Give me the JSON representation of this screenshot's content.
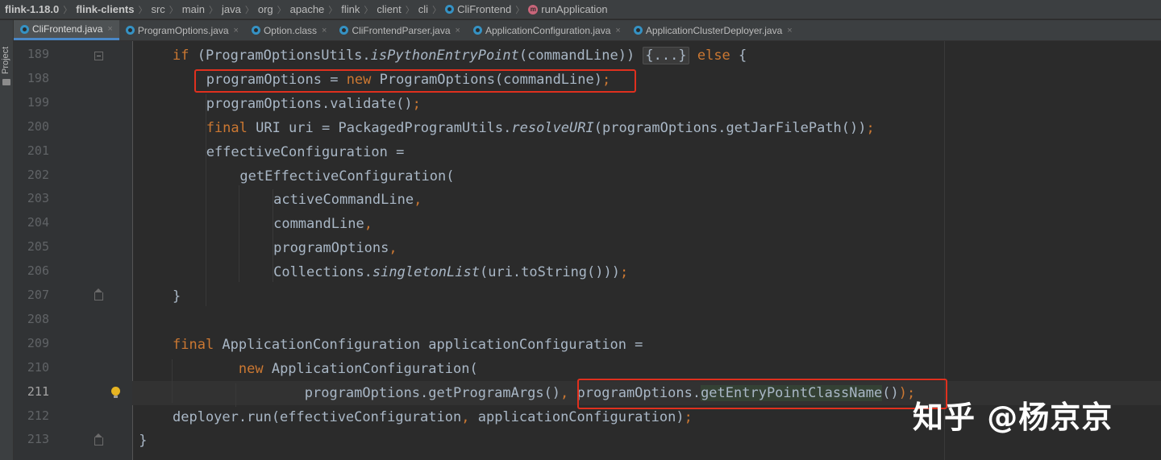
{
  "breadcrumb": [
    {
      "label": "flink-1.18.0",
      "bold": true,
      "icon": ""
    },
    {
      "label": "flink-clients",
      "bold": true,
      "icon": ""
    },
    {
      "label": "src",
      "bold": false,
      "icon": ""
    },
    {
      "label": "main",
      "bold": false,
      "icon": ""
    },
    {
      "label": "java",
      "bold": false,
      "icon": ""
    },
    {
      "label": "org",
      "bold": false,
      "icon": ""
    },
    {
      "label": "apache",
      "bold": false,
      "icon": ""
    },
    {
      "label": "flink",
      "bold": false,
      "icon": ""
    },
    {
      "label": "client",
      "bold": false,
      "icon": ""
    },
    {
      "label": "cli",
      "bold": false,
      "icon": ""
    },
    {
      "label": "CliFrontend",
      "bold": false,
      "icon": "class-icon"
    },
    {
      "label": "runApplication",
      "bold": false,
      "icon": "method-icon"
    }
  ],
  "side_panel": {
    "label": "Project"
  },
  "tabs": [
    {
      "label": "CliFrontend.java",
      "active": true
    },
    {
      "label": "ProgramOptions.java",
      "active": false
    },
    {
      "label": "Option.class",
      "active": false
    },
    {
      "label": "CliFrontendParser.java",
      "active": false
    },
    {
      "label": "ApplicationConfiguration.java",
      "active": false
    },
    {
      "label": "ApplicationClusterDeployer.java",
      "active": false
    }
  ],
  "tab_close": "×",
  "editor": {
    "current_line": "211",
    "lines": [
      {
        "num": "189",
        "indent": 0,
        "tokens": [
          [
            "kw",
            "if "
          ],
          [
            "",
            "(ProgramOptionsUtils."
          ],
          [
            "it",
            "isPythonEntryPoint"
          ],
          [
            "",
            "(commandLine)) "
          ],
          [
            "fold",
            "{...}"
          ],
          [
            "kw",
            " else "
          ],
          [
            "",
            "{"
          ]
        ]
      },
      {
        "num": "198",
        "indent": 1,
        "tokens": [
          [
            "",
            "programOptions = "
          ],
          [
            "kw",
            "new "
          ],
          [
            "",
            "ProgramOptions(commandLine)"
          ],
          [
            "kw",
            ";"
          ]
        ]
      },
      {
        "num": "199",
        "indent": 1,
        "tokens": [
          [
            "",
            "programOptions.validate()"
          ],
          [
            "kw",
            ";"
          ]
        ]
      },
      {
        "num": "200",
        "indent": 1,
        "tokens": [
          [
            "kw",
            "final "
          ],
          [
            "",
            "URI uri = PackagedProgramUtils."
          ],
          [
            "it",
            "resolveURI"
          ],
          [
            "",
            "(programOptions.getJarFilePath())"
          ],
          [
            "kw",
            ";"
          ]
        ]
      },
      {
        "num": "201",
        "indent": 1,
        "tokens": [
          [
            "",
            "effectiveConfiguration ="
          ]
        ]
      },
      {
        "num": "202",
        "indent": 2,
        "tokens": [
          [
            "",
            "getEffectiveConfiguration("
          ]
        ]
      },
      {
        "num": "203",
        "indent": 3,
        "tokens": [
          [
            "",
            "activeCommandLine"
          ],
          [
            "kw",
            ","
          ]
        ]
      },
      {
        "num": "204",
        "indent": 3,
        "tokens": [
          [
            "",
            "commandLine"
          ],
          [
            "kw",
            ","
          ]
        ]
      },
      {
        "num": "205",
        "indent": 3,
        "tokens": [
          [
            "",
            "programOptions"
          ],
          [
            "kw",
            ","
          ]
        ]
      },
      {
        "num": "206",
        "indent": 3,
        "tokens": [
          [
            "",
            "Collections."
          ],
          [
            "it",
            "singletonList"
          ],
          [
            "",
            "(uri.toString()))"
          ],
          [
            "kw",
            ";"
          ]
        ]
      },
      {
        "num": "207",
        "indent": 0,
        "tokens": [
          [
            "",
            "}"
          ]
        ]
      },
      {
        "num": "208",
        "indent": 0,
        "tokens": []
      },
      {
        "num": "209",
        "indent": 0,
        "tokens": [
          [
            "kw",
            "final "
          ],
          [
            "",
            "ApplicationConfiguration applicationConfiguration ="
          ]
        ]
      },
      {
        "num": "210",
        "indent": 0,
        "tokens": [
          [
            "kw",
            "        new "
          ],
          [
            "",
            "ApplicationConfiguration("
          ]
        ]
      },
      {
        "num": "211",
        "indent": 0,
        "tokens": [
          [
            "",
            "                programOptions.getProgramArgs()"
          ],
          [
            "kw",
            ", "
          ],
          [
            "",
            "programOptions."
          ],
          [
            "hl",
            "getEntryPointClassName"
          ],
          [
            "",
            "()"
          ],
          [
            "kw",
            ");"
          ]
        ]
      },
      {
        "num": "212",
        "indent": 0,
        "tokens": [
          [
            "",
            "deployer.run(effectiveConfiguration"
          ],
          [
            "kw",
            ", "
          ],
          [
            "",
            "applicationConfiguration)"
          ],
          [
            "kw",
            ";"
          ]
        ]
      },
      {
        "num": "213",
        "indent": -1,
        "tokens": [
          [
            "",
            "}"
          ]
        ]
      }
    ]
  },
  "watermark": "知乎 @杨京京",
  "colors": {
    "keyword": "#cc7832",
    "text": "#a9b7c6",
    "annotation_box": "#e0301e"
  }
}
